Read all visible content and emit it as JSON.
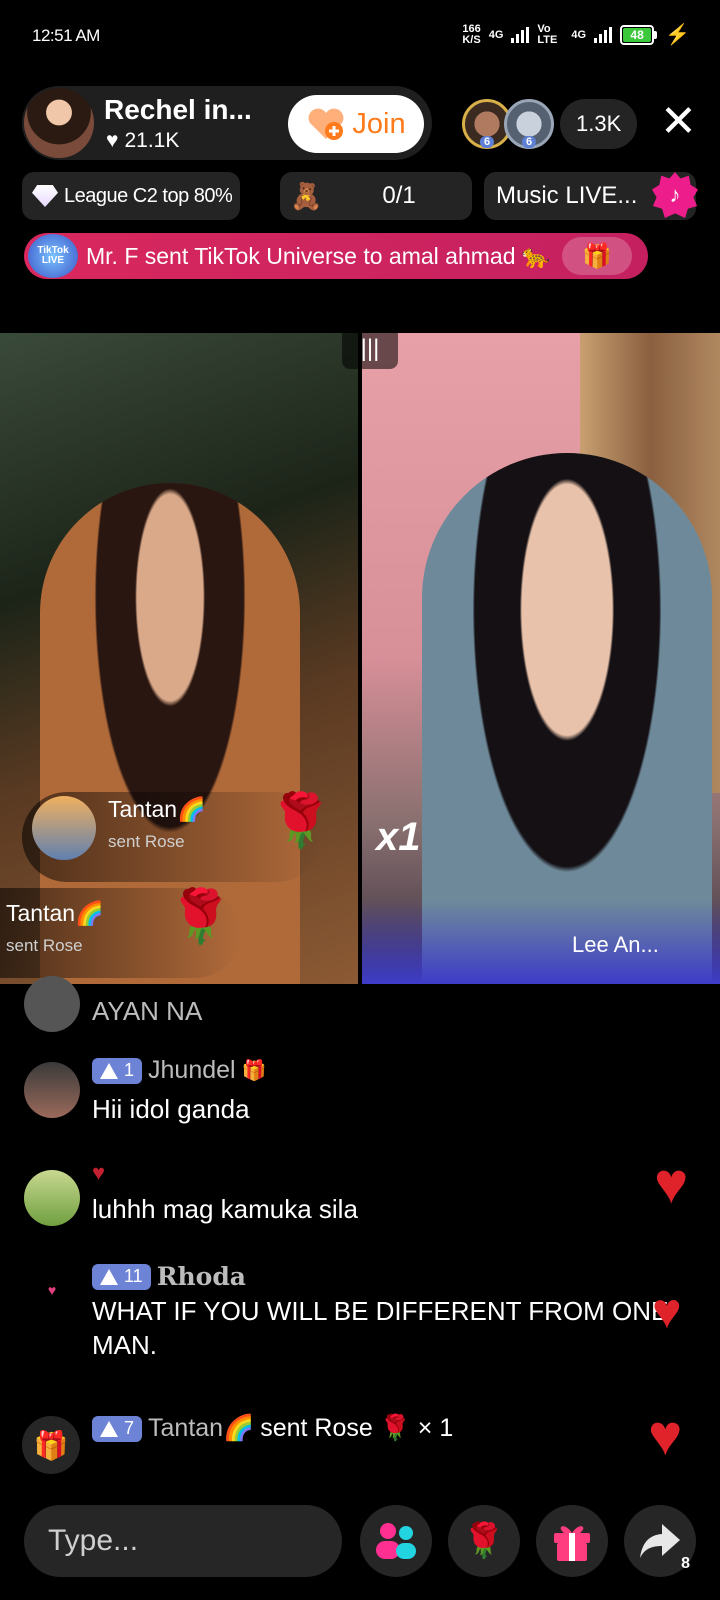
{
  "status": {
    "time": "12:51 AM",
    "net_speed": "166",
    "net_unit": "K/S",
    "sim1": "4G",
    "volte": "Vo LTE",
    "sim2": "4G",
    "battery": "48",
    "battery_color": "#3cc83c"
  },
  "host": {
    "name": "Rechel in...",
    "likes": "21.1K",
    "join_label": "Join"
  },
  "viewers": {
    "avatar1_level": "6",
    "avatar2_level": "6",
    "count": "1.3K"
  },
  "chips": {
    "league": "League C2 top 80%",
    "score": "0/1",
    "music": "Music LIVE..."
  },
  "banner": {
    "logo_text": "TikTok LIVE",
    "text": "Mr. F sent TikTok Universe to amal ahmad 🐆"
  },
  "battle": {
    "multiplier": "x1",
    "guest_name": "Lee An...",
    "popups": [
      {
        "name": "Tantan🌈",
        "action": "sent Rose"
      },
      {
        "name": "Tantan🌈",
        "action": "sent Rose"
      }
    ]
  },
  "chat": {
    "messages": [
      {
        "user": "",
        "level": "",
        "text": "AYAN NA"
      },
      {
        "user": "Jhundel",
        "level": "1",
        "text": "Hii idol ganda"
      },
      {
        "user": "",
        "level": "",
        "text": "luhhh mag kamuka sila"
      },
      {
        "user": "Rhoda",
        "level": "11",
        "text": "WHAT IF YOU WILL BE DIFFERENT FROM ONE MAN."
      },
      {
        "user": "Tantan🌈",
        "level": "7",
        "text": "sent Rose 🌹 × 1"
      }
    ]
  },
  "bottom": {
    "placeholder": "Type...",
    "share_count": "8"
  },
  "colors": {
    "accent": "#ee1d8c",
    "join": "#ff7a1a",
    "heart": "#e0232a",
    "level_badge": "#6d84d6"
  }
}
